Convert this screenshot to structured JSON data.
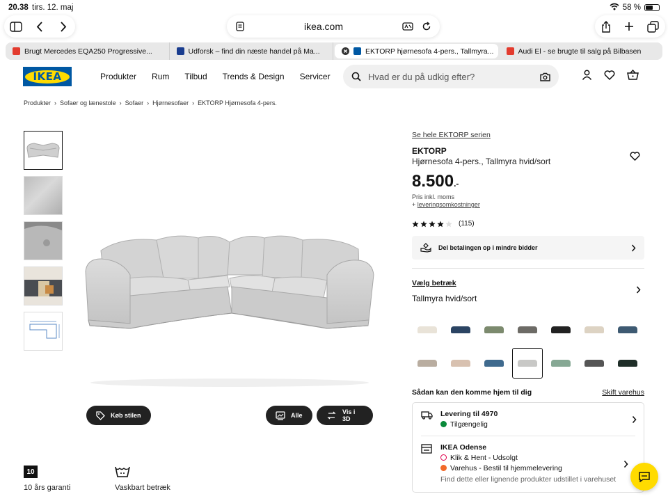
{
  "status": {
    "time": "20.38",
    "date": "tirs. 12. maj",
    "battery": "58 %",
    "battery_level": 0.58
  },
  "browser": {
    "domain": "ikea.com",
    "tabs": [
      {
        "label": "Brugt Mercedes EQA250 Progressive...",
        "fav_color": "#e33b2e"
      },
      {
        "label": "Udforsk – find din næste handel på Ma...",
        "fav_color": "#1a3d8f"
      },
      {
        "label": "EKTORP hjørnesofa 4-pers., Tallmyra...",
        "fav_color": "#0058a3",
        "active": true
      },
      {
        "label": "Audi El - se brugte til salg på Bilbasen",
        "fav_color": "#e33b2e"
      }
    ]
  },
  "header": {
    "logo": "IKEA",
    "nav": [
      "Produkter",
      "Rum",
      "Tilbud",
      "Trends & Design",
      "Servicer"
    ],
    "search_placeholder": "Hvad er du på udkig efter?"
  },
  "breadcrumb": [
    "Produkter",
    "Sofaer og lænestole",
    "Sofaer",
    "Hjørnesofaer",
    "EKTORP Hjørnesofa 4-pers."
  ],
  "gallery": {
    "buttons": {
      "style": "Køb stilen",
      "all": "Alle",
      "view3d": "Vis i 3D"
    }
  },
  "features": [
    {
      "badge": "10",
      "label": "10 års garanti"
    },
    {
      "label": "Vaskbart betræk"
    }
  ],
  "product": {
    "series_link": "Se hele EKTORP serien",
    "name": "EKTORP",
    "description": "Hjørnesofa 4-pers., Tallmyra hvid/sort",
    "price": "8.500",
    "price_suffix": ".-",
    "price_note": "Pris inkl. moms",
    "delivery_cost_prefix": "+",
    "delivery_cost_link": "leveringsomkostninger",
    "rating": 4,
    "reviews": "(115)",
    "pay_banner": "Del betalingen op i mindre bidder"
  },
  "cover": {
    "heading": "Vælg betræk",
    "value": "Tallmyra hvid/sort",
    "swatch_colors": [
      "#e9e3d8",
      "#2b4463",
      "#7c8a6e",
      "#6d6b66",
      "#222222",
      "#ddd3c3",
      "#3e5a72",
      "#b9ada0",
      "#d8c1b0",
      "#3f6a8e",
      "#c8c8c6",
      "#86a894",
      "#555555",
      "#1f2e28"
    ],
    "selected_index": 10
  },
  "delivery": {
    "heading": "Sådan kan den komme hjem til dig",
    "change_store": "Skift varehus",
    "home": {
      "title": "Levering til 4970",
      "status": "Tilgængelig",
      "status_color": "#0a8a3a"
    },
    "store": {
      "title": "IKEA Odense",
      "click_collect": "Klik & Hent - Udsolgt",
      "click_color": "#e0004d",
      "warehouse": "Varehus - Bestil til hjemmelevering",
      "warehouse_color": "#f26a2a",
      "note": "Find dette eller lignende produkter udstillet i varehuset"
    }
  },
  "colors": {
    "ikea_blue": "#0058a3",
    "ikea_yellow": "#ffdb00"
  }
}
